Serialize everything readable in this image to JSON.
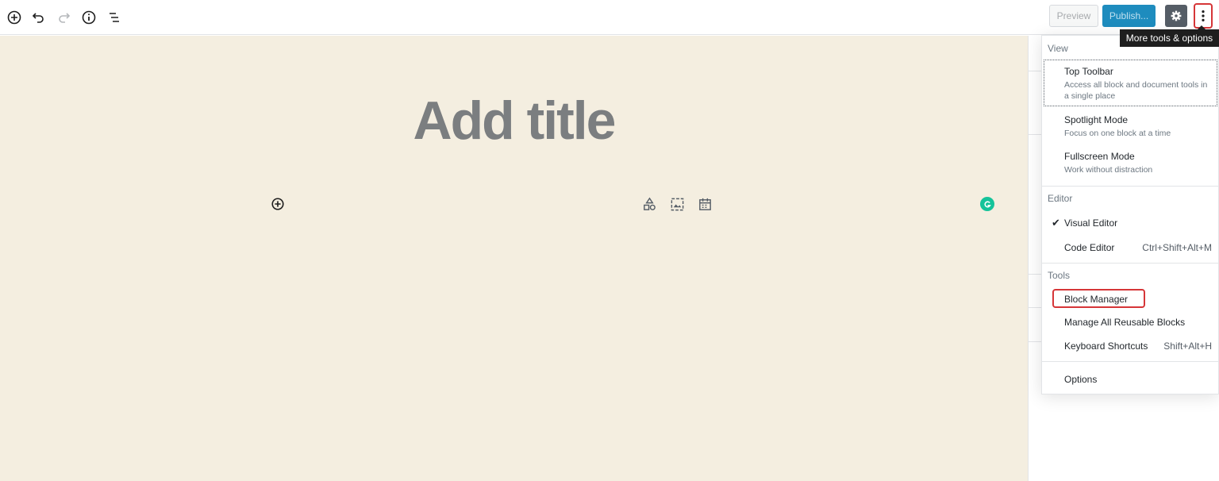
{
  "toolbar": {
    "preview_label": "Preview",
    "publish_label": "Publish...",
    "tooltip": "More tools & options"
  },
  "editor": {
    "title_placeholder": "Add title"
  },
  "menu": {
    "view_label": "View",
    "editor_label": "Editor",
    "tools_label": "Tools",
    "view_items": [
      {
        "label": "Top Toolbar",
        "desc": "Access all block and document tools in a single place"
      },
      {
        "label": "Spotlight Mode",
        "desc": "Focus on one block at a time"
      },
      {
        "label": "Fullscreen Mode",
        "desc": "Work without distraction"
      }
    ],
    "editor_items": [
      {
        "label": "Visual Editor",
        "shortcut": "",
        "checked": true
      },
      {
        "label": "Code Editor",
        "shortcut": "Ctrl+Shift+Alt+M"
      }
    ],
    "tools_items": [
      {
        "label": "Block Manager"
      },
      {
        "label": "Manage All Reusable Blocks"
      },
      {
        "label": "Keyboard Shortcuts",
        "shortcut": "Shift+Alt+H"
      }
    ],
    "options_label": "Options",
    "check_glyph": "✔"
  },
  "colors": {
    "canvas_bg": "#f4eee0",
    "publish_bg": "#1e8cbe",
    "highlight": "#d63638",
    "grammarly": "#15c39a"
  }
}
